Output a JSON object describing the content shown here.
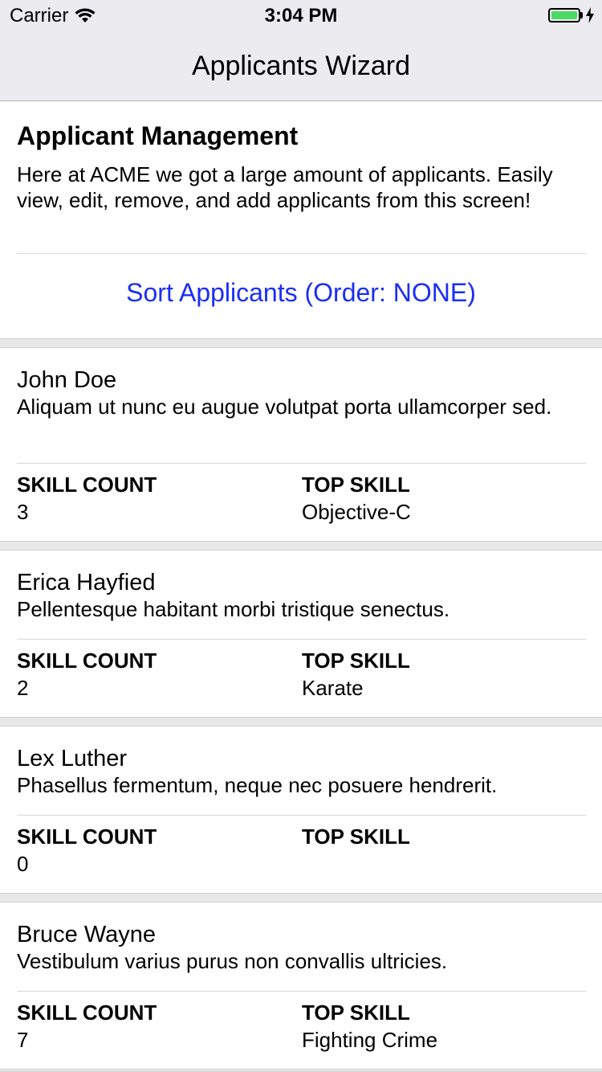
{
  "status_bar": {
    "carrier": "Carrier",
    "time": "3:04 PM",
    "battery_color": "#4cd964"
  },
  "nav": {
    "title": "Applicants Wizard"
  },
  "header": {
    "title": "Applicant Management",
    "description": "Here at ACME we got a large amount of applicants. Easily view, edit, remove, and add applicants from this screen!",
    "sort_button_label": "Sort Applicants (Order: NONE)",
    "sort_button_color": "#1a2ef5"
  },
  "labels": {
    "skill_count": "SKILL COUNT",
    "top_skill": "TOP SKILL"
  },
  "applicants": [
    {
      "name": "John Doe",
      "description": "Aliquam ut nunc eu augue volutpat porta ullamcorper sed.",
      "skill_count": "3",
      "top_skill": "Objective-C"
    },
    {
      "name": "Erica Hayfied",
      "description": "Pellentesque habitant morbi tristique senectus.",
      "skill_count": "2",
      "top_skill": "Karate"
    },
    {
      "name": "Lex Luther",
      "description": "Phasellus fermentum, neque nec posuere hendrerit.",
      "skill_count": "0",
      "top_skill": ""
    },
    {
      "name": "Bruce Wayne",
      "description": "Vestibulum varius purus non convallis ultricies.",
      "skill_count": "7",
      "top_skill": "Fighting Crime"
    }
  ]
}
